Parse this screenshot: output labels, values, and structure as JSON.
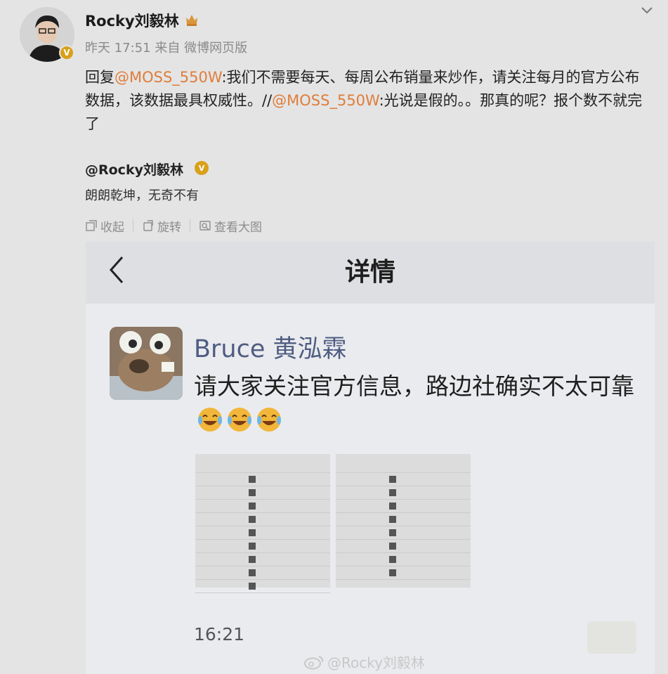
{
  "post": {
    "author_name": "Rocky刘毅林",
    "time": "昨天 17:51",
    "source": "来自 微博网页版",
    "reply_parts": [
      {
        "text": "回复",
        "mention": false
      },
      {
        "text": "@MOSS_550W",
        "mention": true
      },
      {
        "text": ":我们不需要每天、每周公布销量来炒作，请关注每月的官方公布数据，该数据最具权威性。//",
        "mention": false
      },
      {
        "text": "@MOSS_550W",
        "mention": true
      },
      {
        "text": ":光说是假的。。那真的呢？报个数不就完了",
        "mention": false
      }
    ],
    "quoted_user": "@Rocky刘毅林",
    "quoted_text": "朗朗乾坤，无奇不有",
    "actions": {
      "collapse": "收起",
      "rotate": "旋转",
      "view_large": "查看大图"
    }
  },
  "screenshot": {
    "header_title": "详情",
    "commenter_name": "Bruce 黄泓霖",
    "comment_text": "请大家关注官方信息，路边社确实不太可靠",
    "time": "16:21"
  },
  "watermark": "@Rocky刘毅林",
  "colors": {
    "mention": "#e07d3a",
    "verified": "#d9a019",
    "name_blue": "#4f5c82"
  }
}
